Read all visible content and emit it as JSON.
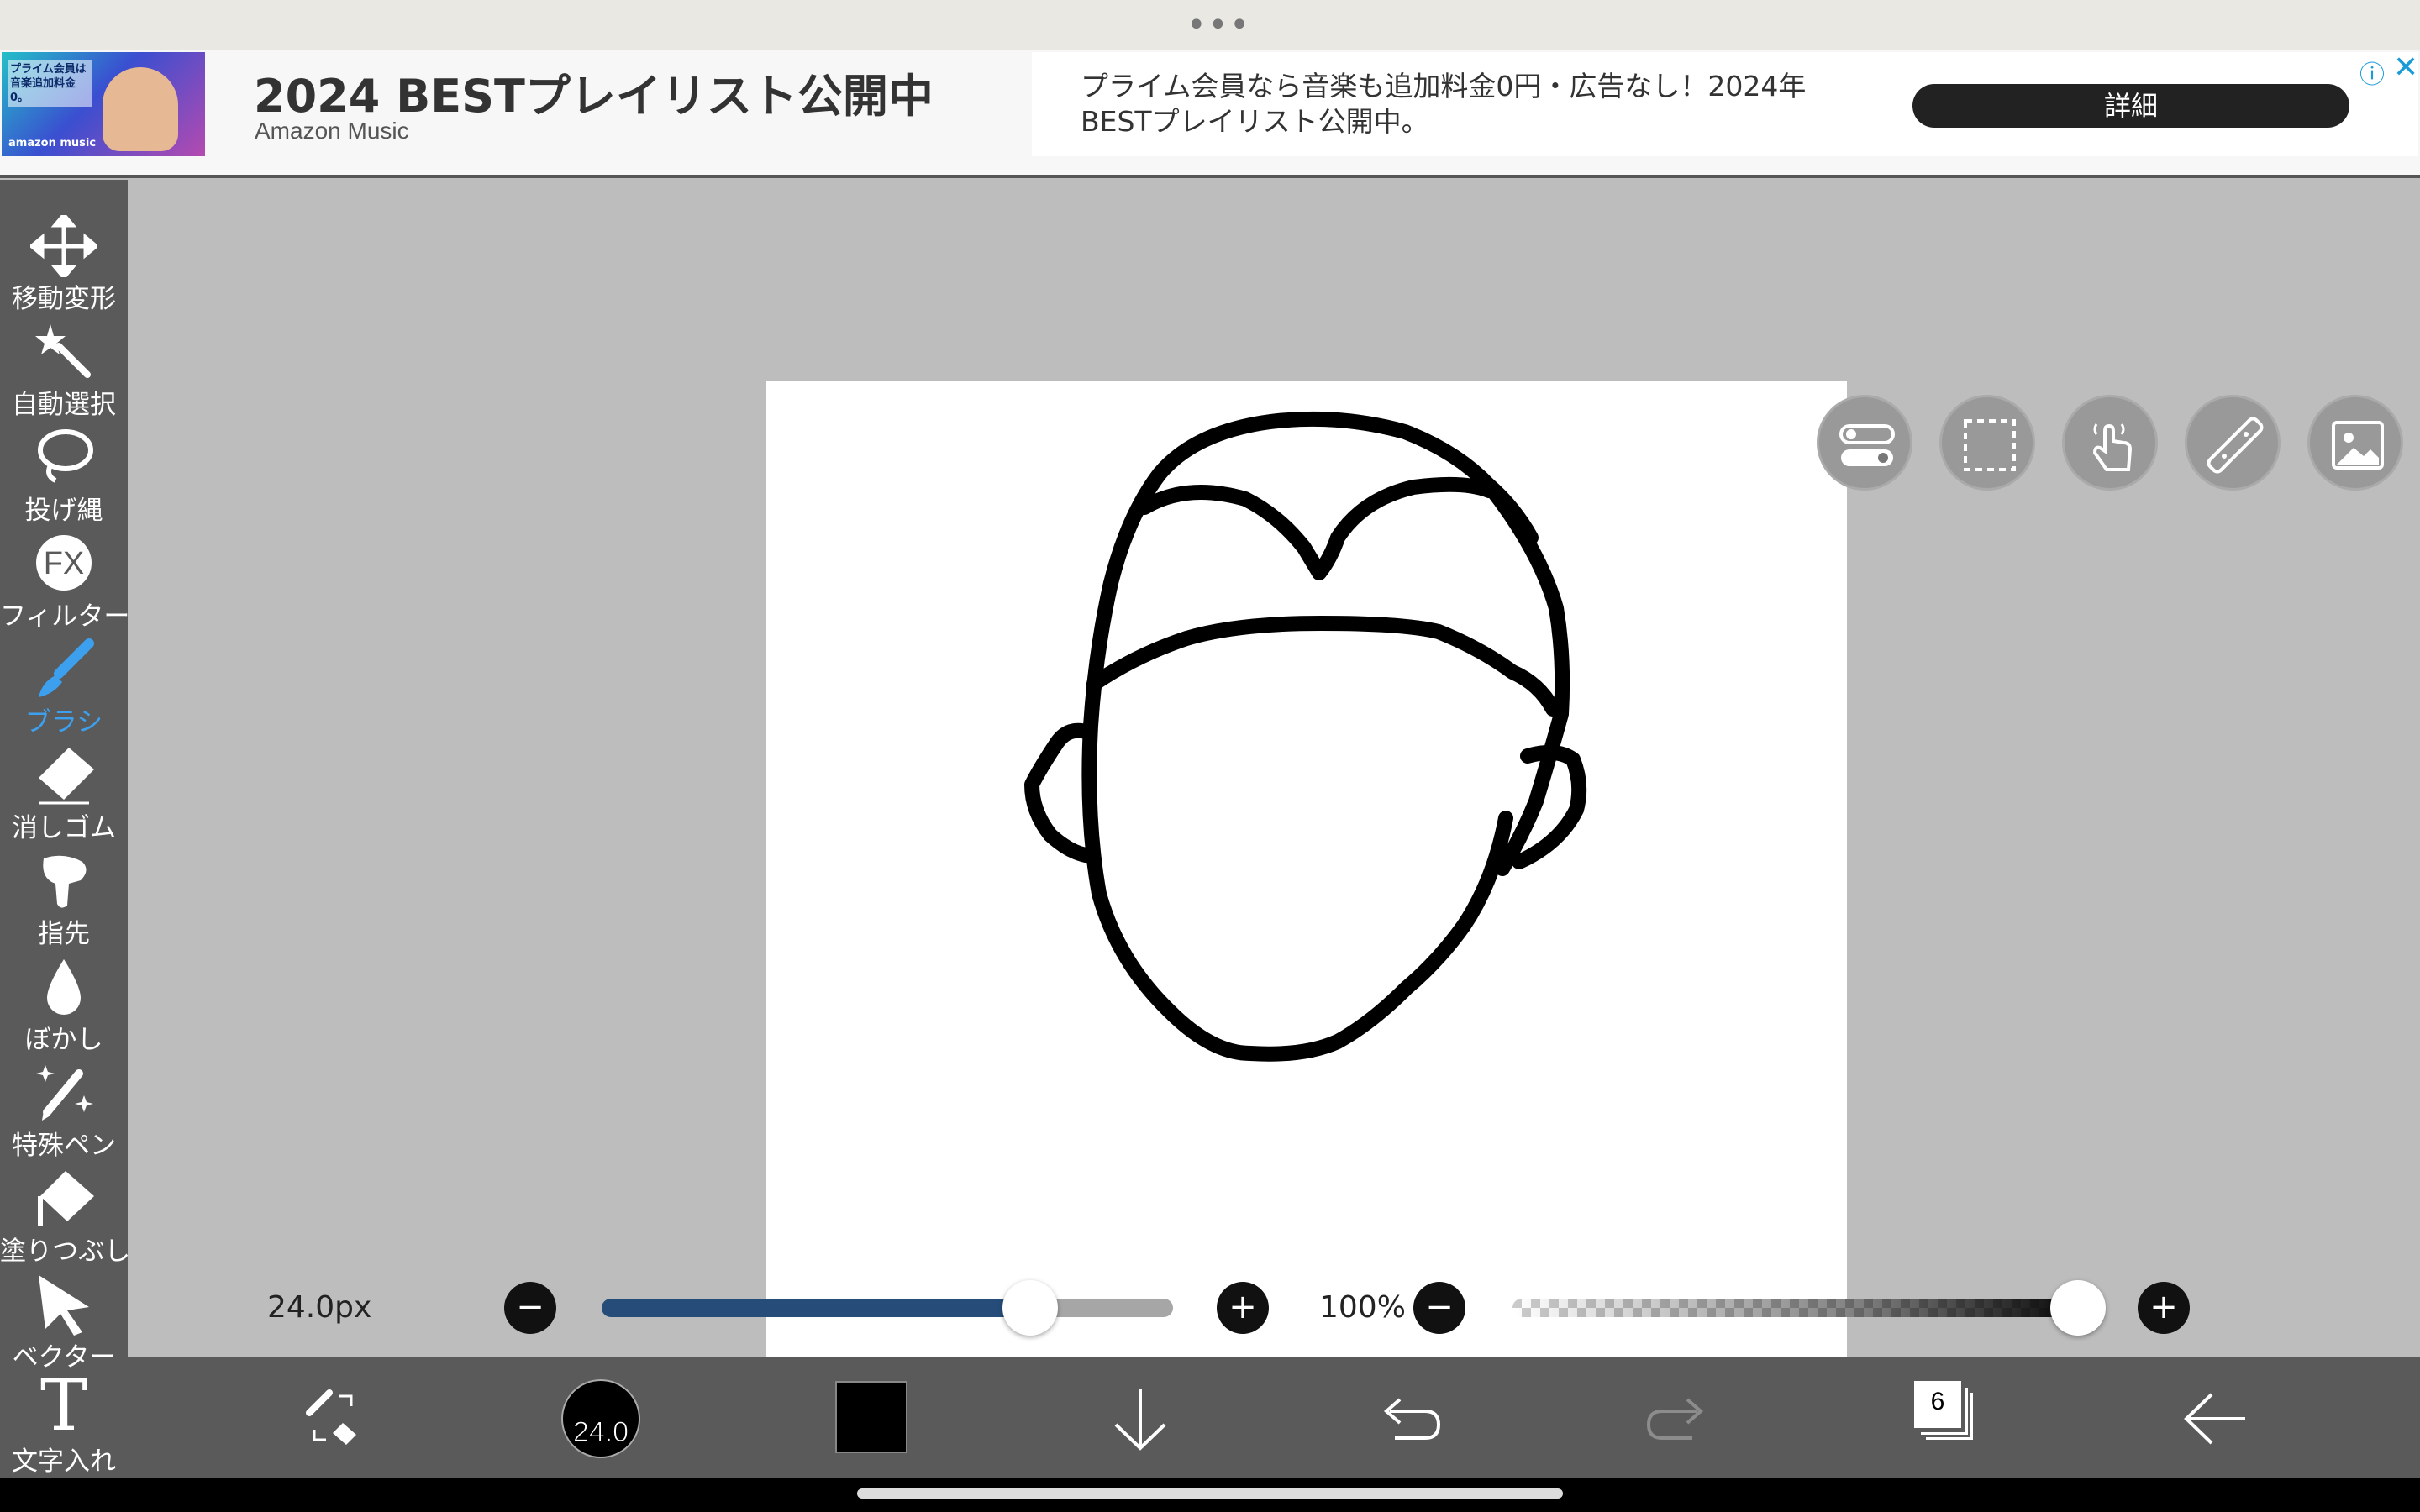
{
  "ad": {
    "image_text": "プライム会員は音楽追加料金0。",
    "image_brand": "amazon music",
    "title": "2024 BESTプレイリスト公開中",
    "subtitle": "Amazon Music",
    "description": "プライム会員なら音楽も追加料金0円・広告なし！2024年BESTプレイリスト公開中。",
    "button_label": "詳細"
  },
  "tools": [
    {
      "label": "移動変形",
      "icon": "move-icon"
    },
    {
      "label": "自動選択",
      "icon": "magic-wand-icon"
    },
    {
      "label": "投げ縄",
      "icon": "lasso-icon"
    },
    {
      "label": "フィルター",
      "icon": "fx-icon"
    },
    {
      "label": "ブラシ",
      "icon": "brush-icon",
      "active": true
    },
    {
      "label": "消しゴム",
      "icon": "eraser-icon"
    },
    {
      "label": "指先",
      "icon": "finger-icon"
    },
    {
      "label": "ぼかし",
      "icon": "blur-drop-icon"
    },
    {
      "label": "特殊ペン",
      "icon": "special-pen-icon"
    },
    {
      "label": "塗りつぶし",
      "icon": "fill-icon"
    },
    {
      "label": "ベクター",
      "icon": "vector-cursor-icon"
    },
    {
      "label": "文字入れ",
      "icon": "text-icon"
    }
  ],
  "fx_text": "FX",
  "text_tool_glyph": "T",
  "brush_size": {
    "label": "24.0px",
    "value": 24.0,
    "fraction": 0.75
  },
  "opacity": {
    "label": "100%",
    "fraction": 1.0
  },
  "bottom": {
    "brush_size_badge": "24.0",
    "color": "#000000",
    "layer_count": "6"
  },
  "colors": {
    "accent": "#3da0ee",
    "slider_fill": "#264d7a"
  }
}
